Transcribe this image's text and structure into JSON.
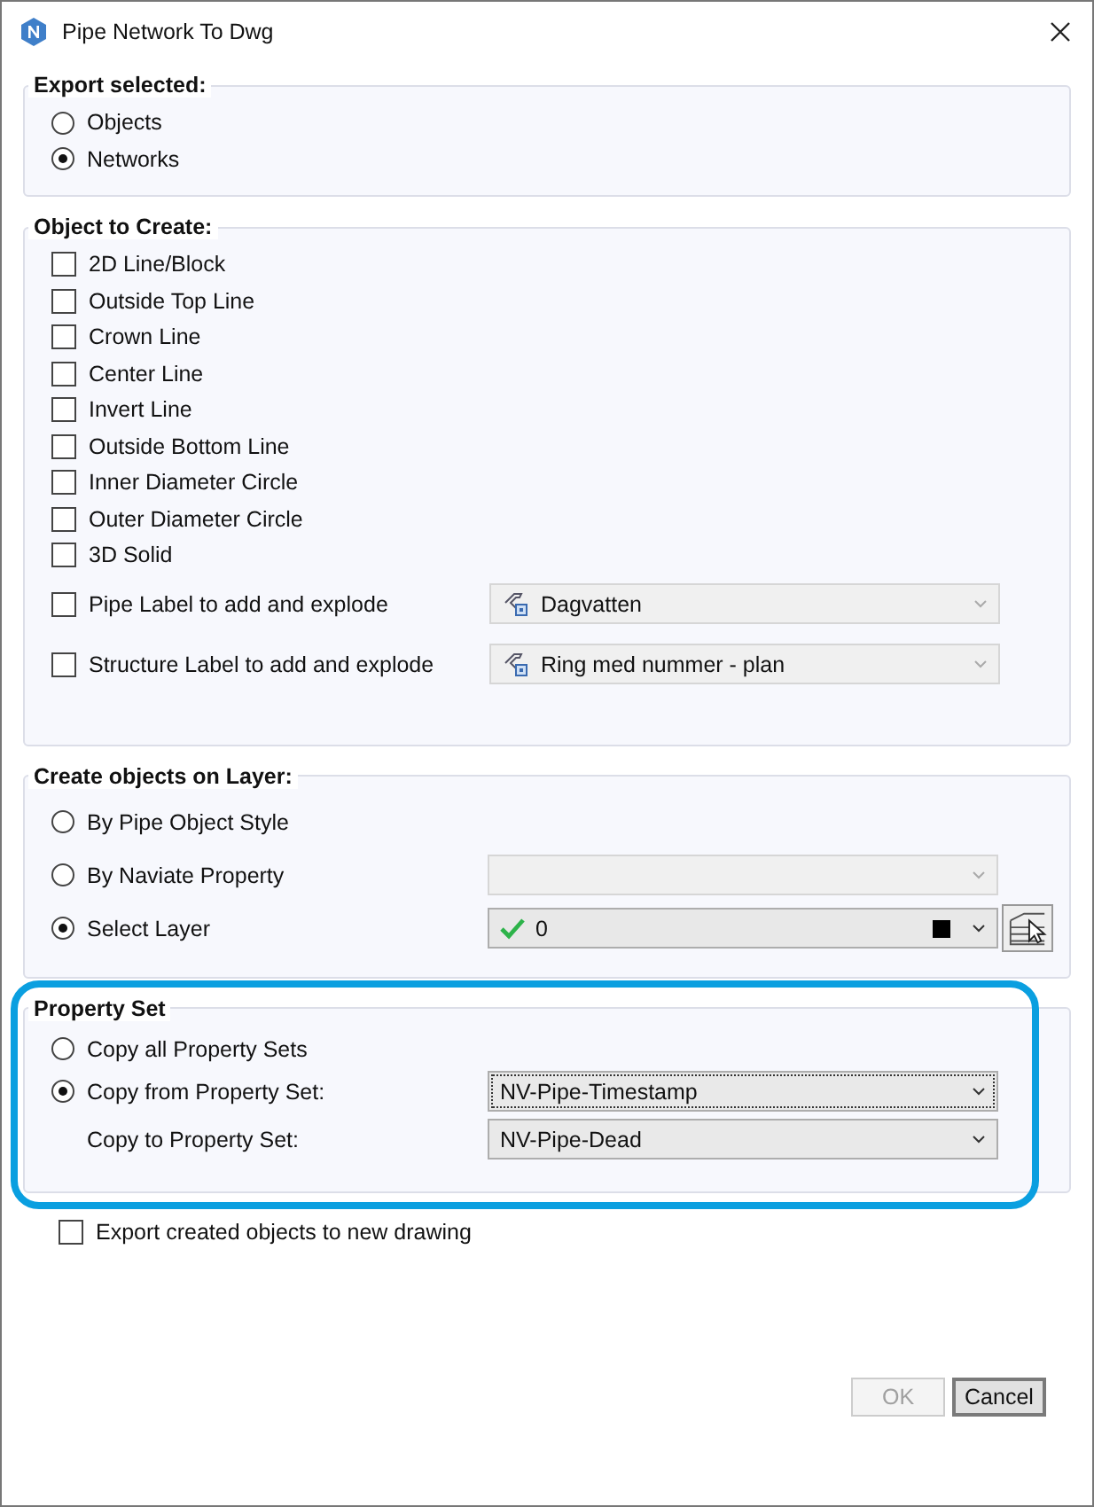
{
  "window": {
    "title": "Pipe Network To Dwg"
  },
  "export_selected": {
    "title": "Export selected:",
    "options": [
      {
        "label": "Objects",
        "selected": false
      },
      {
        "label": "Networks",
        "selected": true
      }
    ]
  },
  "object_to_create": {
    "title": "Object to Create:",
    "items": [
      {
        "label": "2D Line/Block",
        "checked": false
      },
      {
        "label": "Outside Top Line",
        "checked": false
      },
      {
        "label": "Crown Line",
        "checked": false
      },
      {
        "label": "Center Line",
        "checked": false
      },
      {
        "label": "Invert Line",
        "checked": false
      },
      {
        "label": "Outside Bottom Line",
        "checked": false
      },
      {
        "label": "Inner Diameter Circle",
        "checked": false
      },
      {
        "label": "Outer Diameter Circle",
        "checked": false
      },
      {
        "label": "3D Solid",
        "checked": false
      }
    ],
    "label_rows": [
      {
        "label": "Pipe Label to add and explode",
        "checked": false,
        "value": "Dagvatten",
        "disabled": true
      },
      {
        "label": "Structure Label to add and explode",
        "checked": false,
        "value": "Ring med nummer - plan",
        "disabled": true
      }
    ]
  },
  "layer": {
    "title": "Create objects on Layer:",
    "options": [
      {
        "kind": "plain",
        "label": "By Pipe Object Style",
        "selected": false
      },
      {
        "kind": "dropdown",
        "label": "By Naviate Property",
        "selected": false,
        "disabled": true
      },
      {
        "kind": "layer",
        "label": "Select Layer",
        "selected": true,
        "value": "0"
      }
    ]
  },
  "property_set": {
    "title": "Property Set",
    "options": [
      {
        "label": "Copy all Property Sets",
        "selected": false
      },
      {
        "label": "Copy from Property Set:",
        "selected": true,
        "value": "NV-Pipe-Timestamp",
        "focused": true
      }
    ],
    "copy_to": {
      "label": "Copy to Property Set:",
      "value": "NV-Pipe-Dead"
    }
  },
  "export_new_drawing": {
    "label": "Export created objects to new drawing",
    "checked": false
  },
  "buttons": [
    {
      "label": "OK",
      "disabled": true
    },
    {
      "label": "Cancel",
      "disabled": false
    }
  ]
}
